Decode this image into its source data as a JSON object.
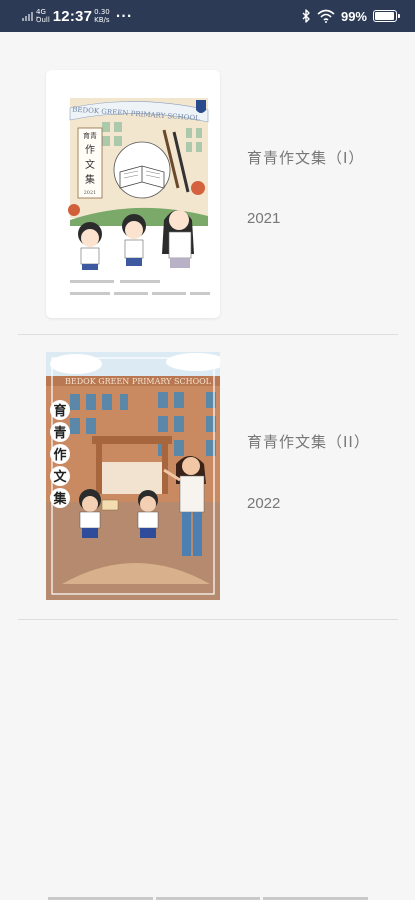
{
  "status_bar": {
    "network_type": "4G",
    "signal_label": "Ꝺull",
    "time": "12:37",
    "speed_value": "0.30",
    "speed_unit": "KB/s",
    "more": "···",
    "battery_percent": "99%",
    "battery_level": 0.99,
    "icons": [
      "signal-bars-icon",
      "bluetooth-icon",
      "wifi-icon",
      "battery-icon"
    ]
  },
  "books": [
    {
      "title": "育青作文集（I）",
      "year": "2021",
      "cover": {
        "school_banner": "BEDOK GREEN PRIMARY SCHOOL",
        "book_title_chars": [
          "育青",
          "作",
          "文",
          "集"
        ],
        "cover_year": "2021"
      }
    },
    {
      "title": "育青作文集（II）",
      "year": "2022",
      "cover": {
        "school_banner": "BEDOK GREEN PRIMARY SCHOOL",
        "book_title_chars": [
          "育",
          "青",
          "作",
          "文",
          "集"
        ]
      }
    }
  ],
  "colors": {
    "status_bar": "#2c3a55",
    "background": "#f6f6f6",
    "divider": "#dedede",
    "text": "#777777"
  }
}
